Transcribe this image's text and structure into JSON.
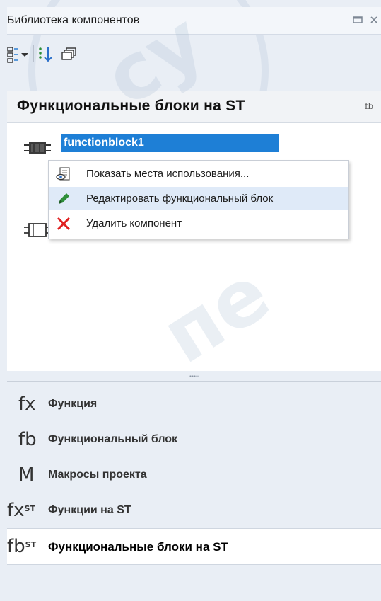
{
  "window": {
    "title": "Библиотека компонентов",
    "restore_icon": "restore-icon",
    "close_icon": "close-icon"
  },
  "toolbar": {
    "view_icon": "view-mode-dropdown-icon",
    "sort_icon": "sort-order-icon",
    "group_icon": "group-components-icon"
  },
  "section": {
    "title": "Функциональные блоки на ST",
    "icon_text": "fb"
  },
  "items": [
    {
      "name": "functionblock1",
      "selected": true
    },
    {
      "name": "",
      "selected": false
    }
  ],
  "context_menu": {
    "items": [
      {
        "label": "Показать места использования...",
        "icon": "usages-icon"
      },
      {
        "label": "Редактировать функциональный блок",
        "icon": "pencil-icon",
        "highlighted": true
      },
      {
        "label": "Удалить компонент",
        "icon": "delete-x-icon"
      }
    ]
  },
  "categories": [
    {
      "icon_text": "fx",
      "icon_sup": "",
      "label": "Функция"
    },
    {
      "icon_text": "fb",
      "icon_sup": "",
      "label": "Функциональный блок"
    },
    {
      "icon_text": "M",
      "icon_sup": "",
      "label": "Макросы проекта"
    },
    {
      "icon_text": "fx",
      "icon_sup": "ST",
      "label": "Функции на ST"
    },
    {
      "icon_text": "fb",
      "icon_sup": "ST",
      "label": "Функциональные блоки на ST",
      "active": true
    }
  ],
  "colors": {
    "selection": "#1e7fd6",
    "menu_highlight": "#dfeaf8",
    "delete_red": "#e02020",
    "pencil_green": "#2f8f3a"
  }
}
